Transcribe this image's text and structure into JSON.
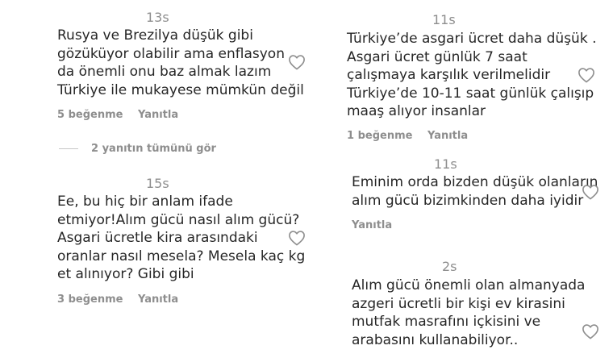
{
  "left_column": {
    "comment1": {
      "time": "13s",
      "lines": [
        "Rusya ve Brezilya düşük gibi",
        "gözüküyor olabilir ama enflasyon",
        "da önemli onu baz almak lazım",
        "Türkiye ile mukayese mümkün değil"
      ],
      "likes": "5 beğenme",
      "reply": "Yanıtla"
    },
    "view_replies": "2 yanıtın tümünü gör",
    "comment2": {
      "time": "15s",
      "lines": [
        "Ee, bu hiç bir anlam ifade",
        "etmiyor!Alım gücü nasıl alım gücü?",
        "Asgari ücretle kira arasındaki",
        "oranlar nasıl mesela? Mesela kaç kg",
        "et alınıyor? Gibi gibi"
      ],
      "likes": "3 beğenme",
      "reply": "Yanıtla"
    }
  },
  "right_column": {
    "comment1": {
      "time": "11s",
      "lines": [
        "Türkiye’de asgari ücret daha düşük .",
        "Asgari ücret günlük 7 saat",
        "çalışmaya karşılık verilmelidir",
        "Türkiye’de 10-11 saat günlük çalışıp",
        "maaş alıyor insanlar"
      ],
      "likes": "1 beğenme",
      "reply": "Yanıtla"
    },
    "comment2": {
      "time": "11s",
      "lines": [
        "Eminim orda bizden düşük olanların",
        "alım gücü bizimkinden daha iyidir"
      ],
      "reply": "Yanıtla"
    },
    "comment3": {
      "time": "2s",
      "lines": [
        "Alım gücü önemli olan almanyada",
        "azgeri ücretli bir kişi ev kirasini",
        "mutfak masrafını içkisini ve",
        "arabasını kullanabiliyor.."
      ]
    }
  },
  "icons": {
    "like": "heart-outline-icon"
  },
  "colors": {
    "text": "#262626",
    "muted": "#8e8e8e",
    "background": "#ffffff"
  }
}
